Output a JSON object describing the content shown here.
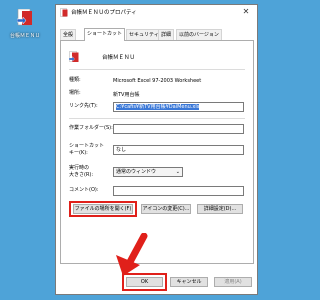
{
  "desktop": {
    "icon_label": "台帳ＭＥＮＵ"
  },
  "window": {
    "title": "台帳ＭＥＮＵのプロパティ",
    "close_glyph": "✕"
  },
  "tabs": [
    {
      "label": "全般",
      "active": false
    },
    {
      "label": "ショートカット",
      "active": true
    },
    {
      "label": "セキュリティ",
      "active": false
    },
    {
      "label": "詳細",
      "active": false
    },
    {
      "label": "以前のバージョン",
      "active": false
    }
  ],
  "shortcut": {
    "name": "台帳ＭＥＮＵ",
    "type_label": "種類:",
    "type_value": "Microsoft Excel 97-2003 Worksheet",
    "location_label": "場所:",
    "location_value": "新TV用台帳",
    "target_label": "リンク先(T):",
    "target_value": "C:¥cafis¥新TV用台帳¥DaiMenu.xls",
    "startin_label": "作業フォルダー(S):",
    "startin_value": "",
    "hotkey_label": "ショートカット\nキー(K):",
    "hotkey_value": "なし",
    "run_label": "実行時の\n大きさ(R):",
    "run_value": "通常のウィンドウ",
    "comment_label": "コメント(O):",
    "comment_value": ""
  },
  "buttons": {
    "open_location": "ファイルの場所を開く(F)",
    "change_icon": "アイコンの変更(C)...",
    "advanced": "詳細設定(D)...",
    "ok": "OK",
    "cancel": "キャンセル",
    "apply": "適用(A)"
  },
  "colors": {
    "highlight_red": "#e0201a",
    "selection_blue": "#3a78d8",
    "desktop": "#4ea3d8"
  }
}
